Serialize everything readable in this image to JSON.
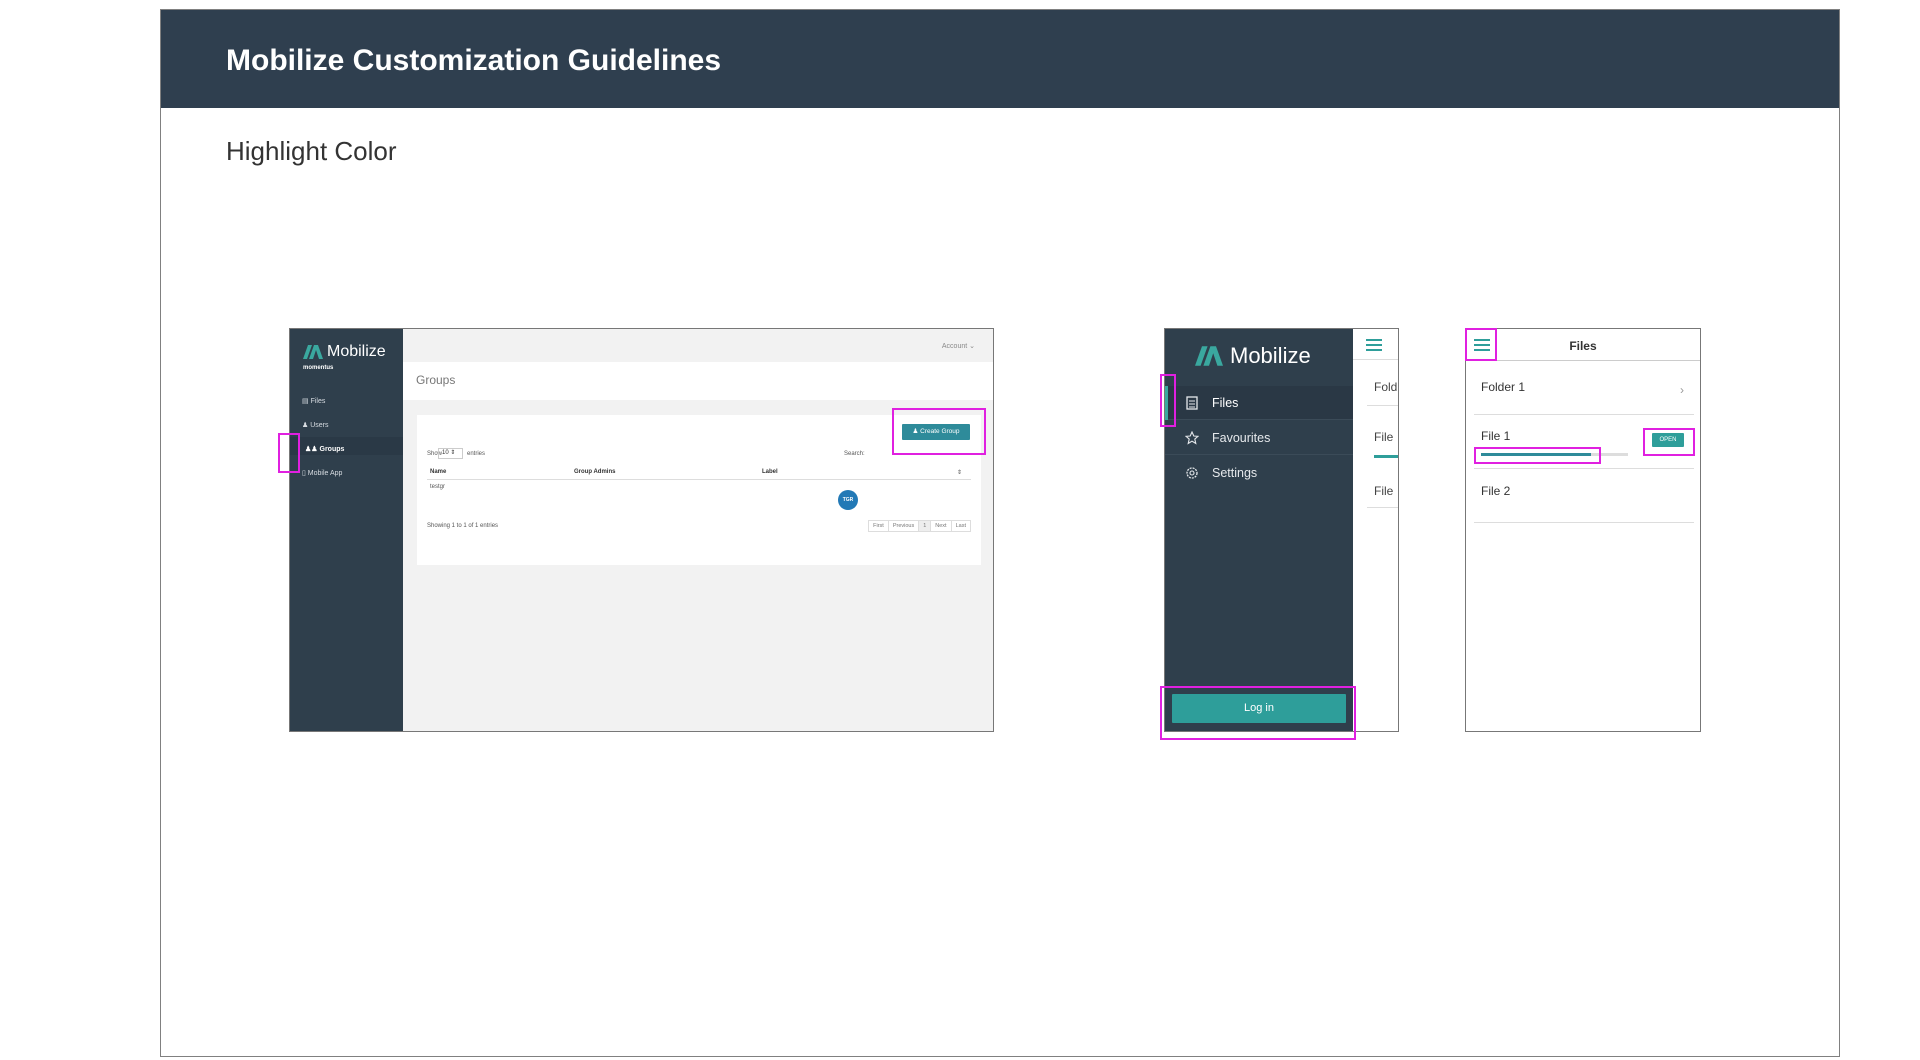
{
  "slide": {
    "title": "Mobilize Customization Guidelines",
    "subtitle": "Highlight Color"
  },
  "colors": {
    "header_bg": "#2f3f4f",
    "sidebar_bg": "#2f3f4c",
    "highlight": "#2e9e9a",
    "annotation_outline": "#e020e0",
    "label_badge": "#2279b6"
  },
  "desktop": {
    "brand": "Mobilize",
    "brand_sub": "momentus",
    "nav": [
      {
        "label": "Files",
        "icon": "file-icon"
      },
      {
        "label": "Users",
        "icon": "user-icon"
      },
      {
        "label": "Groups",
        "icon": "group-icon",
        "active": true
      },
      {
        "label": "Mobile App",
        "icon": "mobile-icon"
      }
    ],
    "account": "Account ⌄",
    "page_title": "Groups",
    "create_button": "Create Group",
    "show_label": "Show",
    "show_value": "10",
    "entries_label": "entries",
    "search_label": "Search:",
    "columns": [
      "Name",
      "Group Admins",
      "Label"
    ],
    "rows": [
      {
        "name": "testgr",
        "admins": "",
        "label": "TGR"
      }
    ],
    "footer_info": "Showing 1 to 1 of 1 entries",
    "pager": [
      "First",
      "Previous",
      "1",
      "Next",
      "Last"
    ]
  },
  "mobile_menu": {
    "brand": "Mobilize",
    "items": [
      {
        "label": "Files",
        "icon": "file-icon",
        "active": true
      },
      {
        "label": "Favourites",
        "icon": "star-icon"
      },
      {
        "label": "Settings",
        "icon": "gear-icon"
      }
    ],
    "login_button": "Log in",
    "peek_rows": [
      "Fold",
      "File",
      "File"
    ]
  },
  "mobile_files": {
    "title": "Files",
    "rows": [
      {
        "label": "Folder 1",
        "chevron": "›"
      },
      {
        "label": "File 1",
        "button": "OPEN",
        "progress": 0.75
      },
      {
        "label": "File 2"
      }
    ]
  }
}
